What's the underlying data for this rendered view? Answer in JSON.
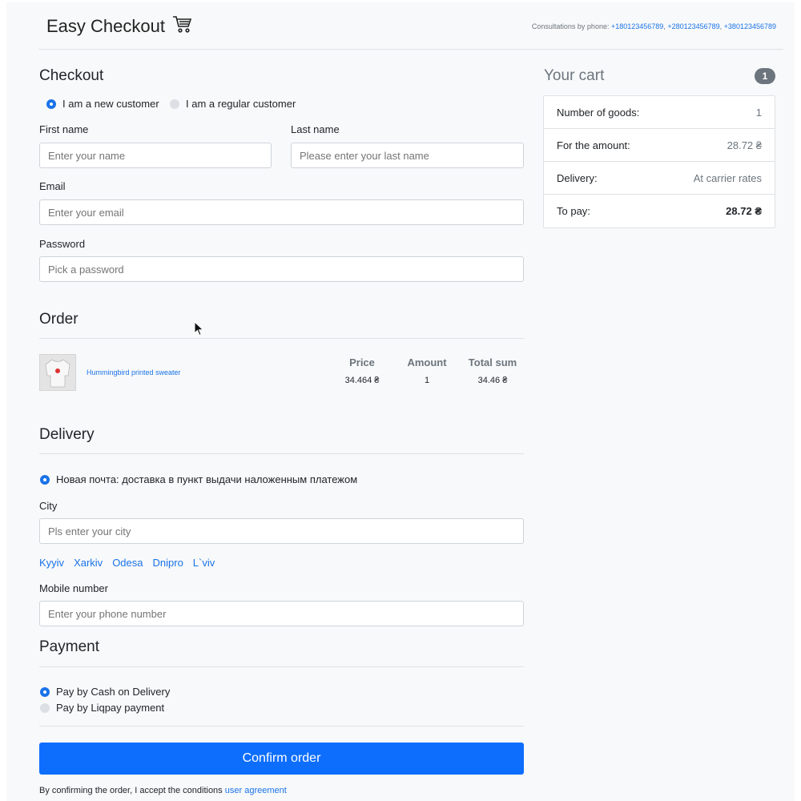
{
  "header": {
    "brand": "Easy Checkout",
    "brand_icon": "cart-icon",
    "consult_label": "Consultations by phone:",
    "phones": [
      "+180123456789",
      "+280123456789",
      "+380123456789"
    ]
  },
  "checkout": {
    "title": "Checkout",
    "customer_types": [
      {
        "label": "I am a new customer",
        "selected": true
      },
      {
        "label": "I am a regular customer",
        "selected": false
      }
    ],
    "first_name": {
      "label": "First name",
      "placeholder": "Enter your name",
      "value": ""
    },
    "last_name": {
      "label": "Last name",
      "placeholder": "Please enter your last name",
      "value": ""
    },
    "email": {
      "label": "Email",
      "placeholder": "Enter your email",
      "value": ""
    },
    "password": {
      "label": "Password",
      "placeholder": "Pick a password",
      "value": ""
    }
  },
  "order": {
    "title": "Order",
    "columns": [
      "Price",
      "Amount",
      "Total sum"
    ],
    "items": [
      {
        "name": "Hummingbird printed sweater",
        "price": "34.464 ₴",
        "amount": "1",
        "total": "34.46 ₴"
      }
    ]
  },
  "delivery": {
    "title": "Delivery",
    "option": "Новая почта: доставка в пункт выдачи наложенным платежом",
    "city": {
      "label": "City",
      "placeholder": "Pls enter your city",
      "value": ""
    },
    "quick_cities": [
      "Kyyiv",
      "Xarkiv",
      "Odesa",
      "Dnipro",
      "L`viv"
    ],
    "mobile": {
      "label": "Mobile number",
      "placeholder": "Enter your phone number",
      "value": ""
    }
  },
  "payment": {
    "title": "Payment",
    "options": [
      {
        "label": "Pay by Cash on Delivery",
        "selected": true
      },
      {
        "label": "Pay by Liqpay payment",
        "selected": false
      }
    ]
  },
  "confirm": {
    "button": "Confirm order",
    "terms_prefix": "By confirming the order, I accept the conditions",
    "terms_link": "user agreement"
  },
  "cart": {
    "title": "Your cart",
    "badge": "1",
    "rows": [
      {
        "label": "Number of goods:",
        "value": "1"
      },
      {
        "label": "For the amount:",
        "value": "28.72 ₴"
      },
      {
        "label": "Delivery:",
        "value": "At carrier rates"
      },
      {
        "label": "To pay:",
        "value": "28.72 ₴"
      }
    ]
  },
  "colors": {
    "accent": "#0d6efd",
    "link": "#1a73e8",
    "background": "#f8f9fa"
  }
}
